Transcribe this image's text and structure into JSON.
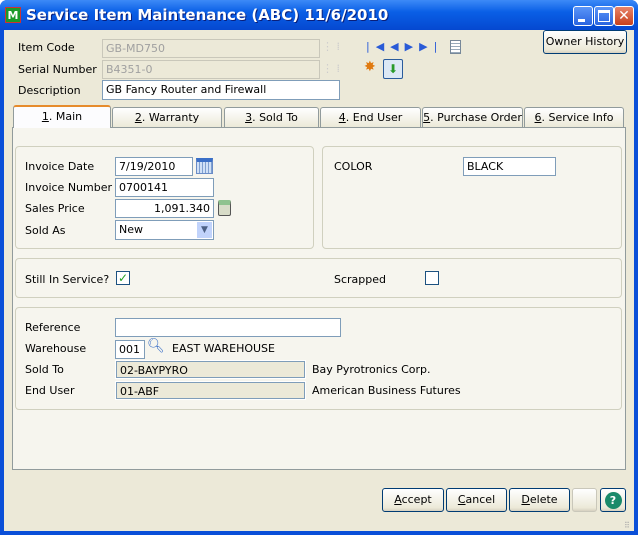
{
  "window": {
    "title": "Service Item Maintenance (ABC) 11/6/2010",
    "app_icon": "M"
  },
  "header": {
    "owner_history": "Owner History",
    "item_code_label": "Item Code",
    "item_code": "GB-MD750",
    "serial_label": "Serial Number",
    "serial": "B4351-0",
    "description_label": "Description",
    "description": "GB Fancy Router and Firewall"
  },
  "tabs": [
    {
      "num": "1",
      "label": ". Main"
    },
    {
      "num": "2",
      "label": ". Warranty"
    },
    {
      "num": "3",
      "label": ". Sold To"
    },
    {
      "num": "4",
      "label": ". End User"
    },
    {
      "num": "5",
      "label": ". Purchase Order"
    },
    {
      "num": "6",
      "label": ". Service Info"
    }
  ],
  "main": {
    "invoice_date_label": "Invoice Date",
    "invoice_date": "7/19/2010",
    "invoice_number_label": "Invoice Number",
    "invoice_number": "0700141",
    "sales_price_label": "Sales Price",
    "sales_price": "1,091.340",
    "sold_as_label": "Sold As",
    "sold_as": "New",
    "color_label": "COLOR",
    "color": "BLACK",
    "still_in_service_label": "Still In Service?",
    "still_in_service": true,
    "scrapped_label": "Scrapped",
    "scrapped": false,
    "reference_label": "Reference",
    "reference": "",
    "warehouse_label": "Warehouse",
    "warehouse": "001",
    "warehouse_name": "EAST WAREHOUSE",
    "sold_to_label": "Sold To",
    "sold_to": "02-BAYPYRO",
    "sold_to_name": "Bay Pyrotronics Corp.",
    "end_user_label": "End User",
    "end_user": "01-ABF",
    "end_user_name": "American Business Futures"
  },
  "footer": {
    "accept_key": "A",
    "accept": "ccept",
    "cancel_key": "C",
    "cancel": "ancel",
    "delete_key": "D",
    "delete": "elete",
    "help": "?"
  }
}
